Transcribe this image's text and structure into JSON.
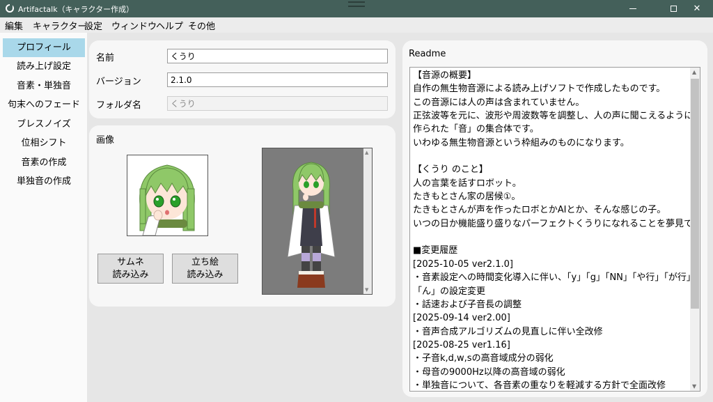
{
  "window": {
    "title": "Artifactalk（キャラクター作成）",
    "min_glyph": "",
    "close_glyph": "✕"
  },
  "menu": [
    "編集",
    "キャラクター",
    "設定",
    "ウィンドウ",
    "ヘルプ",
    "その他"
  ],
  "sidebar": {
    "active_index": 0,
    "items": [
      "プロフィール",
      "読み上げ設定",
      "音素・単独音",
      "句末へのフェード",
      "ブレスノイズ",
      "位相シフト",
      "音素の作成",
      "単独音の作成"
    ]
  },
  "profile": {
    "name_label": "名前",
    "name_value": "くうり",
    "version_label": "バージョン",
    "version_value": "2.1.0",
    "folder_label": "フォルダ名",
    "folder_value": "くうり"
  },
  "images": {
    "title": "画像",
    "thumb_button": [
      "サムネ",
      "読み込み"
    ],
    "stand_button": [
      "立ち絵",
      "読み込み"
    ]
  },
  "readme": {
    "title": "Readme",
    "lines": [
      "【音源の概要】",
      "自作の無生物音源による読み上げソフトで作成したものです。",
      "この音源には人の声は含まれていません。",
      "正弦波等を元に、波形や周波数等を調整し、人の声に聞こえるように",
      "作られた「音」の集合体です。",
      "いわゆる無生物音源という枠組みのものになります。",
      "",
      "【くうり のこと】",
      "人の言葉を話すロボット。",
      "たきもとさん家の居候①。",
      "たきもとさんが声を作ったロボとかAIとか、そんな感じの子。",
      "いつの日か機能盛り盛りなパーフェクトくうりになれることを夢見ている。",
      "",
      "■変更履歴",
      "[2025-10-05 ver2.1.0]",
      "・音素設定への時間変化導入に伴い、「y」「g」「NN」「や行」「が行」",
      "「ん」の設定変更",
      "・話速および子音長の調整",
      "[2025-09-14 ver2.00]",
      "・音声合成アルゴリズムの見直しに伴い全改修",
      "[2025-08-25 ver1.16]",
      "・子音k,d,w,sの高音域成分の弱化",
      "・母音の9000Hz以降の高音域の弱化",
      "・単独音について、各音素の重なりを軽減する方針で全面改修"
    ]
  },
  "colors": {
    "titlebar": "#44605a",
    "sidebar_active": "#a9d8ea",
    "hair": "#8fc868",
    "eyes": "#2aa02a",
    "stand_bg": "#7c7c7c"
  }
}
